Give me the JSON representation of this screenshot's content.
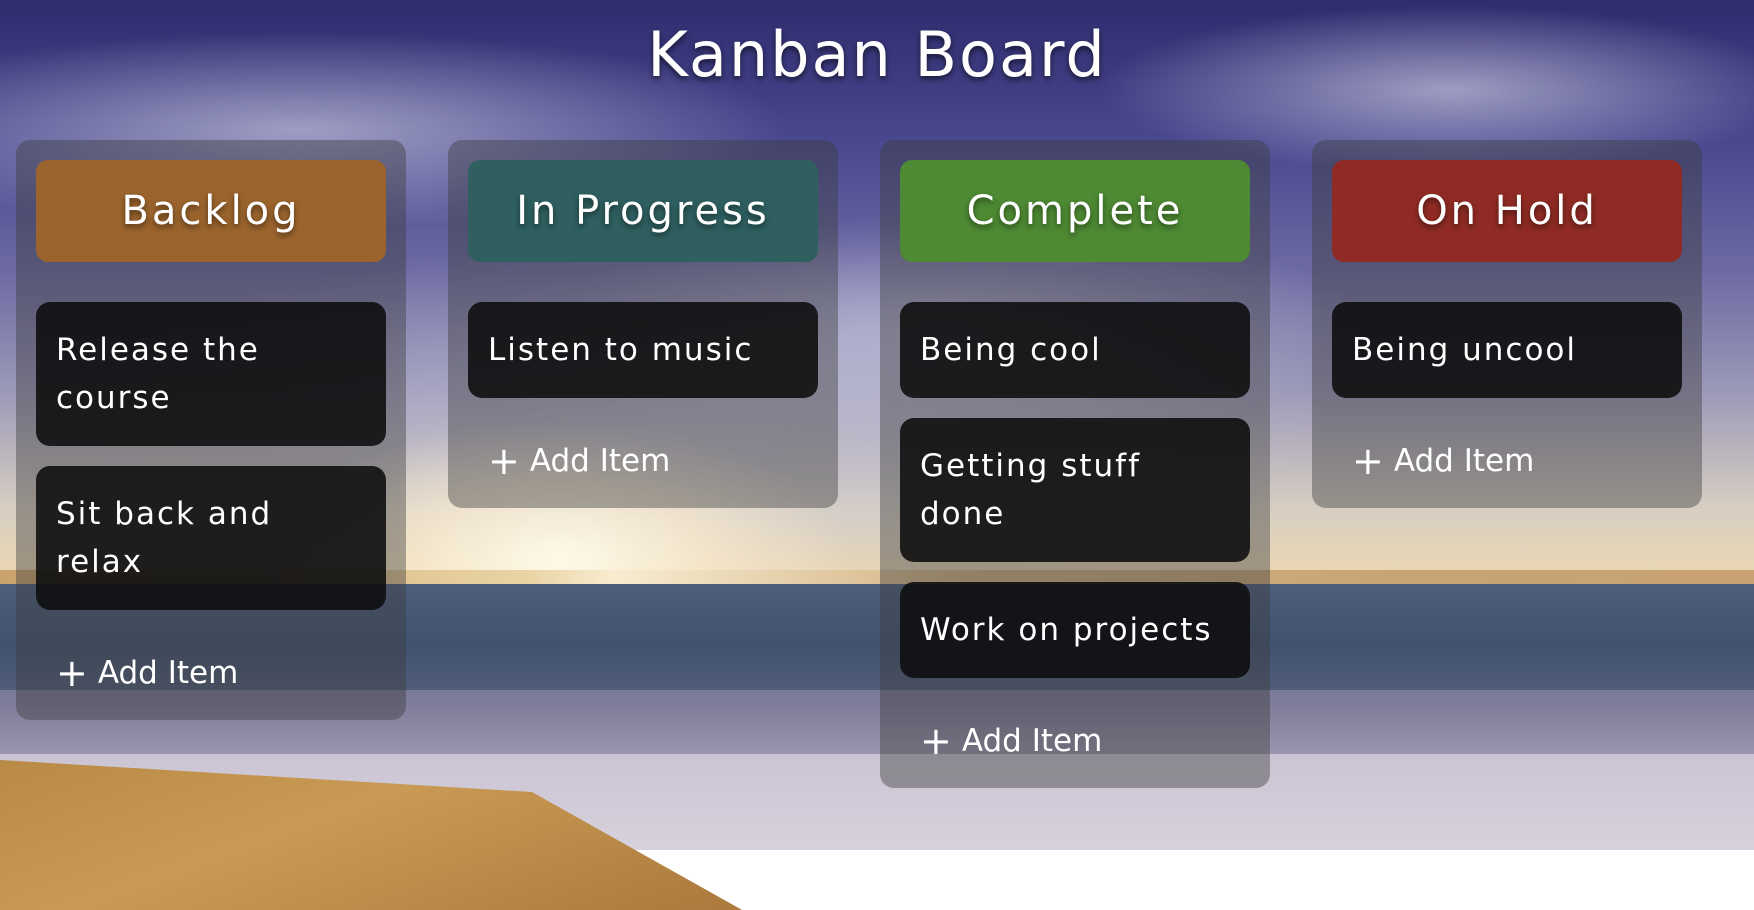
{
  "title": "Kanban Board",
  "columns": [
    {
      "title": "Backlog",
      "color": "#9b642d",
      "items": [
        "Release the course",
        "Sit back and relax"
      ],
      "add_label": "Add Item"
    },
    {
      "title": "In Progress",
      "color": "#2f5f5f",
      "items": [
        "Listen to music"
      ],
      "add_label": "Add Item"
    },
    {
      "title": "Complete",
      "color": "#4d8a33",
      "items": [
        "Being cool",
        "Getting stuff done",
        "Work on projects"
      ],
      "add_label": "Add Item"
    },
    {
      "title": "On Hold",
      "color": "#8f2b24",
      "items": [
        "Being uncool"
      ],
      "add_label": "Add Item"
    }
  ],
  "icons": {
    "add": "plus-icon"
  }
}
